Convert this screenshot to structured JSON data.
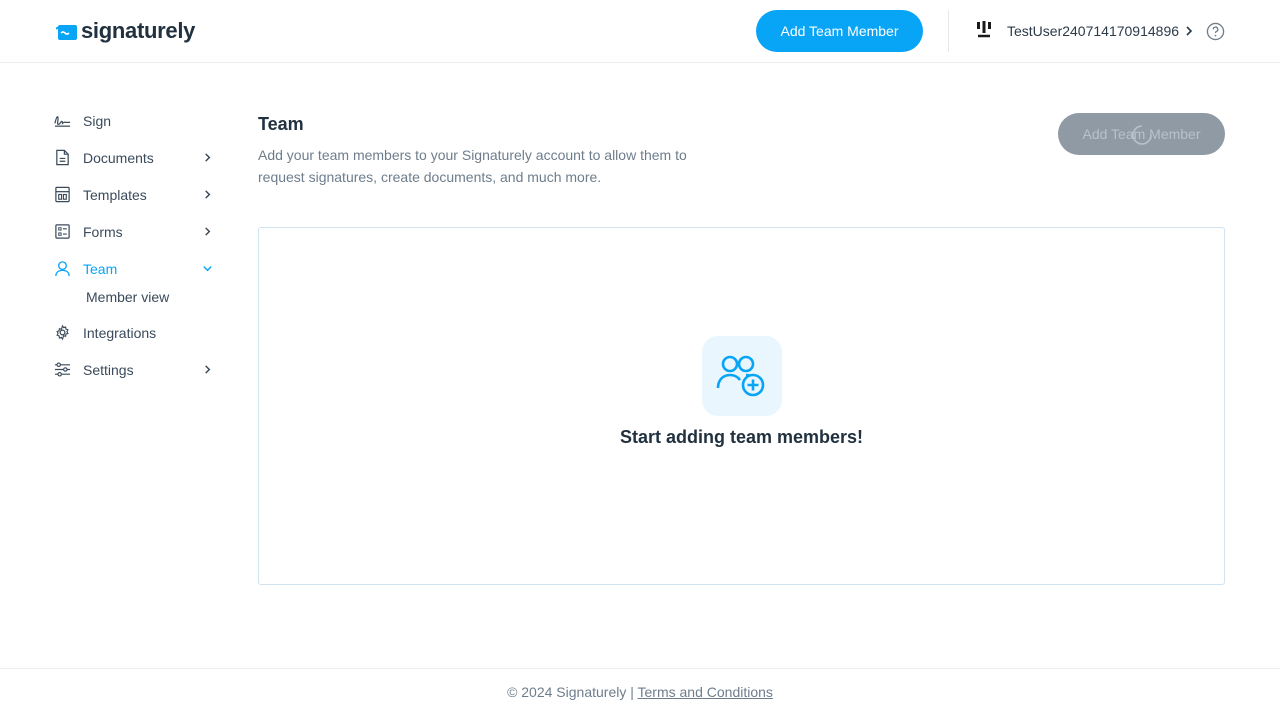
{
  "header": {
    "logo_text": "signaturely",
    "add_member_label": "Add Team Member",
    "user_name": "TestUser240714170914896"
  },
  "sidebar": {
    "items": [
      {
        "label": "Sign",
        "icon": "signature-icon"
      },
      {
        "label": "Documents",
        "icon": "document-icon"
      },
      {
        "label": "Templates",
        "icon": "template-icon"
      },
      {
        "label": "Forms",
        "icon": "form-icon"
      },
      {
        "label": "Team",
        "icon": "user-icon"
      },
      {
        "label": "Integrations",
        "icon": "gear-icon"
      },
      {
        "label": "Settings",
        "icon": "sliders-icon"
      }
    ],
    "team_sub": {
      "label": "Member view"
    }
  },
  "main": {
    "title": "Team",
    "description": "Add your team members to your Signaturely account to allow them to request signatures, create documents, and much more.",
    "add_member_label": "Add Team Member",
    "empty_title": "Start adding team members!"
  },
  "footer": {
    "copyright": "© 2024 Signaturely | ",
    "terms_label": "Terms and Conditions"
  },
  "colors": {
    "accent": "#08a4f5",
    "disabled_button": "#8f9aa5",
    "text_dark": "#22313f",
    "text_muted": "#6e7d8c"
  }
}
